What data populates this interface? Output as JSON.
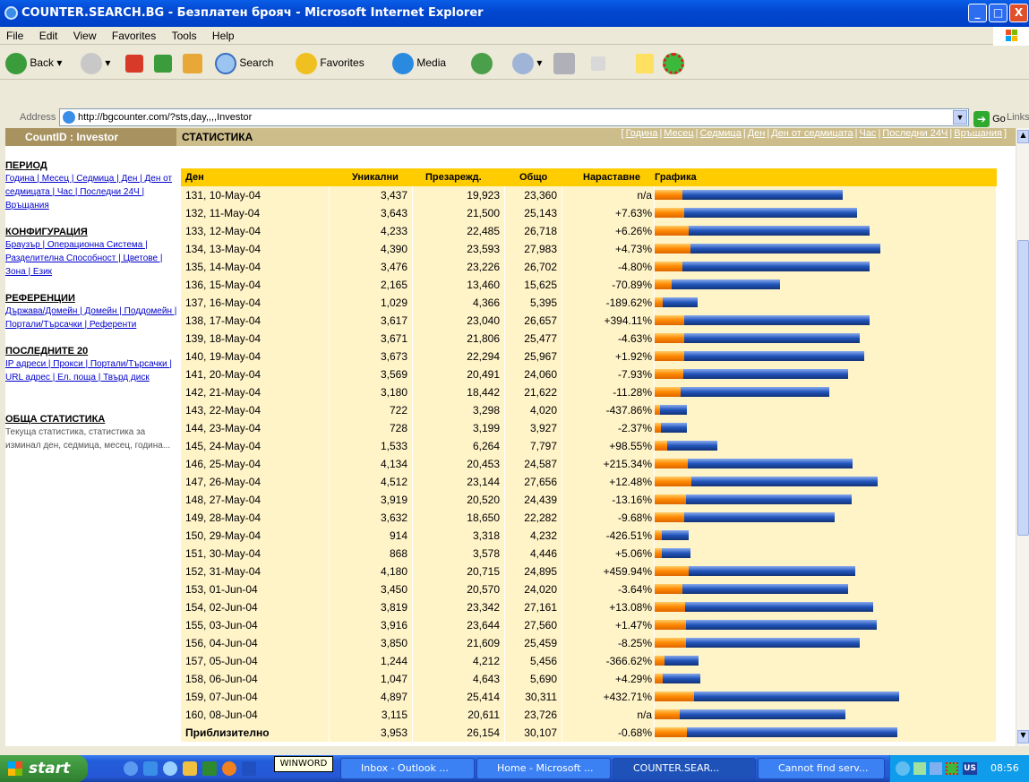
{
  "window": {
    "title": "COUNTER.SEARCH.BG - Безплатен брояч - Microsoft Internet Explorer",
    "minimize": "_",
    "maximize": "□",
    "close": "X"
  },
  "menu": [
    "File",
    "Edit",
    "View",
    "Favorites",
    "Tools",
    "Help"
  ],
  "toolbar": {
    "back": "Back",
    "search": "Search",
    "favorites": "Favorites",
    "media": "Media"
  },
  "address": {
    "label": "Address",
    "url": "http://bgcounter.com/?sts,day,,,,Investor",
    "go": "Go",
    "links": "Links"
  },
  "header": {
    "countid": "CountID : Investor",
    "section": "СТАТИСТИКА",
    "nav": [
      "Година",
      "Месец",
      "Седмица",
      "Ден",
      "Ден от седмицата",
      "Час",
      "Последни 24Ч",
      "Връщания"
    ]
  },
  "sidebar": {
    "period_title": "ПЕРИОД",
    "period_links": "Година | Месец | Седмица | Ден | Ден от седмицата | Час | Последни 24Ч | Връщания",
    "config_title": "КОНФИГУРАЦИЯ",
    "config_links": "Браузър | Операционна Система | Разделителна Способност | Цветове | Зона | Език",
    "ref_title": "РЕФЕРЕНЦИИ",
    "ref_links": "Държава/Домейн | Домейн | Поддомейн | Портали/Търсачки | Референти",
    "last_title": "ПОСЛЕДНИТЕ 20",
    "last_links": "IP адреси | Прокси | Портали/Търсачки | URL адрес | Ел. поща | Твърд диск",
    "general_title": "ОБЩА СТАТИСТИКА",
    "general_text": "Текуща статистика, статистика за изминал ден, седмица, месец, година..."
  },
  "table": {
    "headers": [
      "Ден",
      "Уникални",
      "Презарежд.",
      "Общо",
      "Нараставне",
      "Графика"
    ],
    "rows": [
      [
        "131, 10-May-04",
        "3,437",
        "19,923",
        "23,360",
        "n/a"
      ],
      [
        "132, 11-May-04",
        "3,643",
        "21,500",
        "25,143",
        "+7.63%"
      ],
      [
        "133, 12-May-04",
        "4,233",
        "22,485",
        "26,718",
        "+6.26%"
      ],
      [
        "134, 13-May-04",
        "4,390",
        "23,593",
        "27,983",
        "+4.73%"
      ],
      [
        "135, 14-May-04",
        "3,476",
        "23,226",
        "26,702",
        "-4.80%"
      ],
      [
        "136, 15-May-04",
        "2,165",
        "13,460",
        "15,625",
        "-70.89%"
      ],
      [
        "137, 16-May-04",
        "1,029",
        "4,366",
        "5,395",
        "-189.62%"
      ],
      [
        "138, 17-May-04",
        "3,617",
        "23,040",
        "26,657",
        "+394.11%"
      ],
      [
        "139, 18-May-04",
        "3,671",
        "21,806",
        "25,477",
        "-4.63%"
      ],
      [
        "140, 19-May-04",
        "3,673",
        "22,294",
        "25,967",
        "+1.92%"
      ],
      [
        "141, 20-May-04",
        "3,569",
        "20,491",
        "24,060",
        "-7.93%"
      ],
      [
        "142, 21-May-04",
        "3,180",
        "18,442",
        "21,622",
        "-11.28%"
      ],
      [
        "143, 22-May-04",
        "722",
        "3,298",
        "4,020",
        "-437.86%"
      ],
      [
        "144, 23-May-04",
        "728",
        "3,199",
        "3,927",
        "-2.37%"
      ],
      [
        "145, 24-May-04",
        "1,533",
        "6,264",
        "7,797",
        "+98.55%"
      ],
      [
        "146, 25-May-04",
        "4,134",
        "20,453",
        "24,587",
        "+215.34%"
      ],
      [
        "147, 26-May-04",
        "4,512",
        "23,144",
        "27,656",
        "+12.48%"
      ],
      [
        "148, 27-May-04",
        "3,919",
        "20,520",
        "24,439",
        "-13.16%"
      ],
      [
        "149, 28-May-04",
        "3,632",
        "18,650",
        "22,282",
        "-9.68%"
      ],
      [
        "150, 29-May-04",
        "914",
        "3,318",
        "4,232",
        "-426.51%"
      ],
      [
        "151, 30-May-04",
        "868",
        "3,578",
        "4,446",
        "+5.06%"
      ],
      [
        "152, 31-May-04",
        "4,180",
        "20,715",
        "24,895",
        "+459.94%"
      ],
      [
        "153, 01-Jun-04",
        "3,450",
        "20,570",
        "24,020",
        "-3.64%"
      ],
      [
        "154, 02-Jun-04",
        "3,819",
        "23,342",
        "27,161",
        "+13.08%"
      ],
      [
        "155, 03-Jun-04",
        "3,916",
        "23,644",
        "27,560",
        "+1.47%"
      ],
      [
        "156, 04-Jun-04",
        "3,850",
        "21,609",
        "25,459",
        "-8.25%"
      ],
      [
        "157, 05-Jun-04",
        "1,244",
        "4,212",
        "5,456",
        "-366.62%"
      ],
      [
        "158, 06-Jun-04",
        "1,047",
        "4,643",
        "5,690",
        "+4.29%"
      ],
      [
        "159, 07-Jun-04",
        "4,897",
        "25,414",
        "30,311",
        "+432.71%"
      ],
      [
        "160, 08-Jun-04",
        "3,115",
        "20,611",
        "23,726",
        "n/a"
      ],
      [
        "Приблизително",
        "3,953",
        "26,154",
        "30,107",
        "-0.68%"
      ]
    ]
  },
  "taskbar": {
    "start": "start",
    "tooltip": "WINWORD",
    "tasks": [
      "Inbox - Outlook ...",
      "Home - Microsoft ...",
      "COUNTER.SEAR...",
      "Cannot find serv..."
    ],
    "lang": "US",
    "time": "08:56"
  },
  "colors": {
    "header_yellow": "#ffcc00",
    "row_bg": "#fff3c8",
    "bar_orange": "#ff8800",
    "bar_blue": "#2255bb",
    "countid_bg": "#a89360"
  }
}
